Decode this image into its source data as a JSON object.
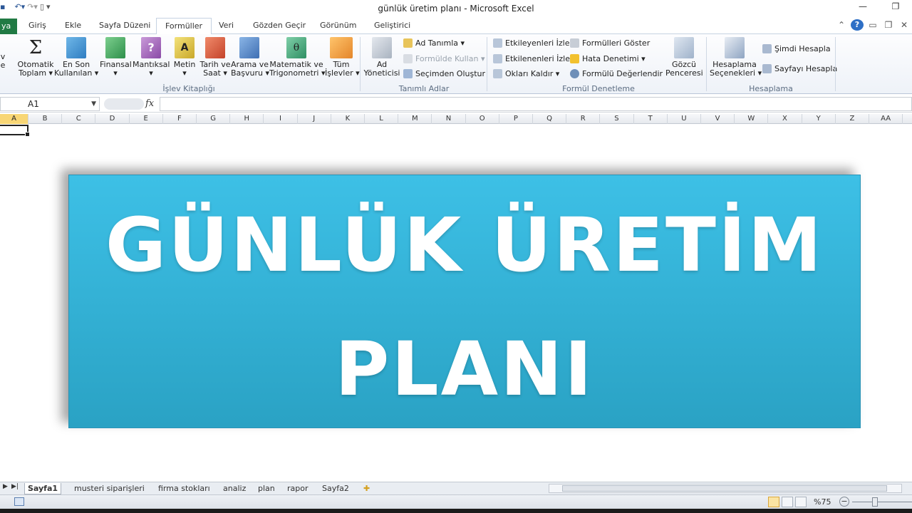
{
  "window": {
    "title": "günlük üretim planı  -  Microsoft Excel"
  },
  "tabs": {
    "file": "ya",
    "items": [
      "Giriş",
      "Ekle",
      "Sayfa Düzeni",
      "Formüller",
      "Veri",
      "Gözden Geçir",
      "Görünüm",
      "Geliştirici"
    ],
    "active": "Formüller"
  },
  "ribbon": {
    "islev": {
      "label": "İşlev Kitaplığı",
      "edge": "v\ne",
      "autosum": [
        "Otomatik",
        "Toplam ▾"
      ],
      "recent": [
        "En Son",
        "Kullanılan ▾"
      ],
      "financial": [
        "Finansal",
        "▾"
      ],
      "logical": [
        "Mantıksal",
        "▾"
      ],
      "text": [
        "Metin",
        "▾"
      ],
      "datetime": [
        "Tarih ve",
        "Saat ▾"
      ],
      "lookup": [
        "Arama ve",
        "Başvuru ▾"
      ],
      "math": [
        "Matematik ve",
        "Trigonometri ▾"
      ],
      "all": [
        "Tüm",
        "İşlevler ▾"
      ]
    },
    "names": {
      "label": "Tanımlı Adlar",
      "manager": [
        "Ad",
        "Yöneticisi"
      ],
      "define": "Ad Tanımla ▾",
      "use_in_formula": "Formülde Kullan ▾",
      "create_from_selection": "Seçimden Oluştur"
    },
    "audit": {
      "label": "Formül Denetleme",
      "trace_precedents": "Etkileyenleri İzle",
      "trace_dependents": "Etkilenenleri İzle",
      "remove_arrows": "Okları Kaldır ▾",
      "show_formulas": "Formülleri Göster",
      "error_checking": "Hata Denetimi ▾",
      "evaluate": "Formülü Değerlendir",
      "watch": [
        "Gözcü",
        "Penceresi"
      ]
    },
    "calc": {
      "label": "Hesaplama",
      "options": [
        "Hesaplama",
        "Seçenekleri ▾"
      ],
      "calc_now": "Şimdi Hesapla",
      "calc_sheet": "Sayfayı Hesapla"
    }
  },
  "formula_bar": {
    "name_box": "A1",
    "fx": "fx",
    "value": ""
  },
  "columns": [
    "A",
    "B",
    "C",
    "D",
    "E",
    "F",
    "G",
    "H",
    "I",
    "J",
    "K",
    "L",
    "M",
    "N",
    "O",
    "P",
    "Q",
    "R",
    "S",
    "T",
    "U",
    "V",
    "W",
    "X",
    "Y",
    "Z",
    "AA"
  ],
  "selected_column": "A",
  "banner": {
    "line1": "GÜNLÜK ÜRETİM",
    "line2": "PLANI"
  },
  "sheets": [
    "Sayfa1",
    "musteri siparişleri",
    "firma stokları",
    "analiz",
    "plan",
    "rapor",
    "Sayfa2"
  ],
  "active_sheet": "Sayfa1",
  "status": {
    "zoom": "%75"
  },
  "colors": {
    "banner_top": "#3dc0e6",
    "banner_bottom": "#2aa2c4",
    "file_tab": "#217a44",
    "selected_col": "#f8d675"
  }
}
